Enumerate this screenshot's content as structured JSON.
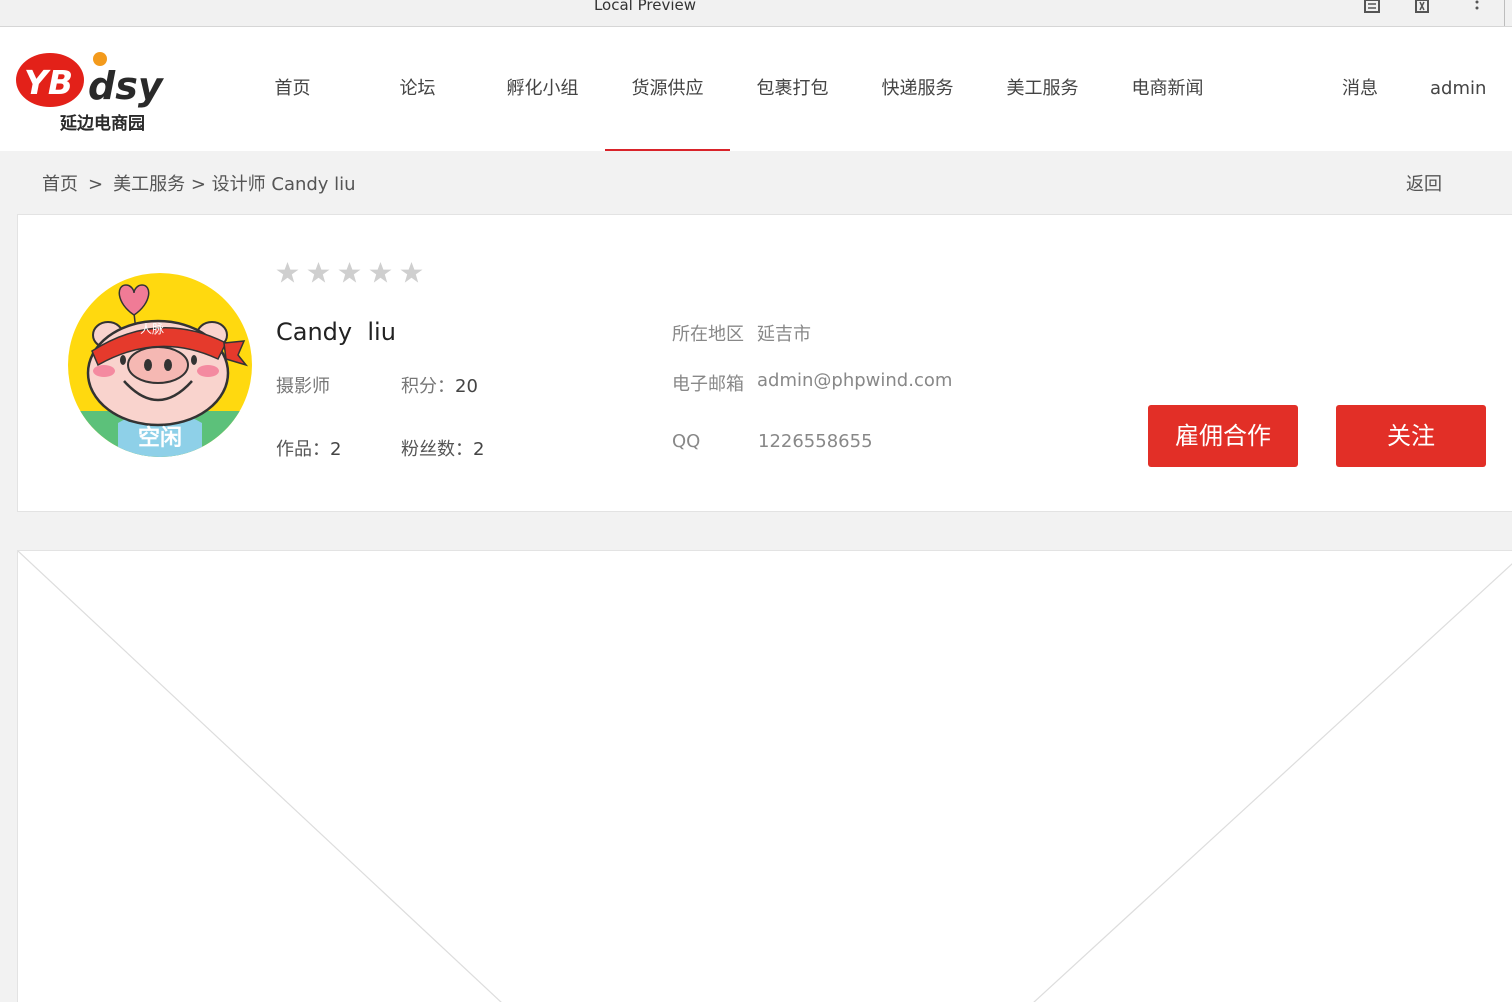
{
  "browser": {
    "title": "Local Preview",
    "icons": [
      "document-icon",
      "extension-icon",
      "more-vertical-icon"
    ]
  },
  "header": {
    "logo": {
      "wordmark": "YBdsy",
      "tagline": "延边电商园"
    },
    "nav": [
      {
        "label": "首页"
      },
      {
        "label": "论坛"
      },
      {
        "label": "孵化小组"
      },
      {
        "label": "货源供应",
        "active": true
      },
      {
        "label": "包裹打包"
      },
      {
        "label": "快递服务"
      },
      {
        "label": "美工服务"
      },
      {
        "label": "电商新闻"
      }
    ],
    "messages": "消息",
    "user": "admin"
  },
  "breadcrumb": {
    "home": "首页",
    "sep1": ">",
    "section": "美工服务",
    "sep2": ">",
    "current": "设计师 Candy liu",
    "back": "返回"
  },
  "profile": {
    "avatar_status": "空闲",
    "avatar_bandana": "人脉",
    "rating": 0,
    "rating_max": 5,
    "name": "Candy  liu",
    "role": "摄影师",
    "points_label": "积分：",
    "points": "20",
    "works_label": "作品：",
    "works": "2",
    "fans_label": "粉丝数：",
    "fans": "2",
    "region_label": "所在地区",
    "region": "延吉市",
    "email_label": "电子邮箱",
    "email": "admin@phpwind.com",
    "qq_label": "QQ",
    "qq": "1226558655",
    "hire_button": "雇佣合作",
    "follow_button": "关注"
  },
  "colors": {
    "accent": "#e22f27",
    "nav_active_underline": "#d9232a",
    "star_inactive": "#cfcfcf"
  }
}
